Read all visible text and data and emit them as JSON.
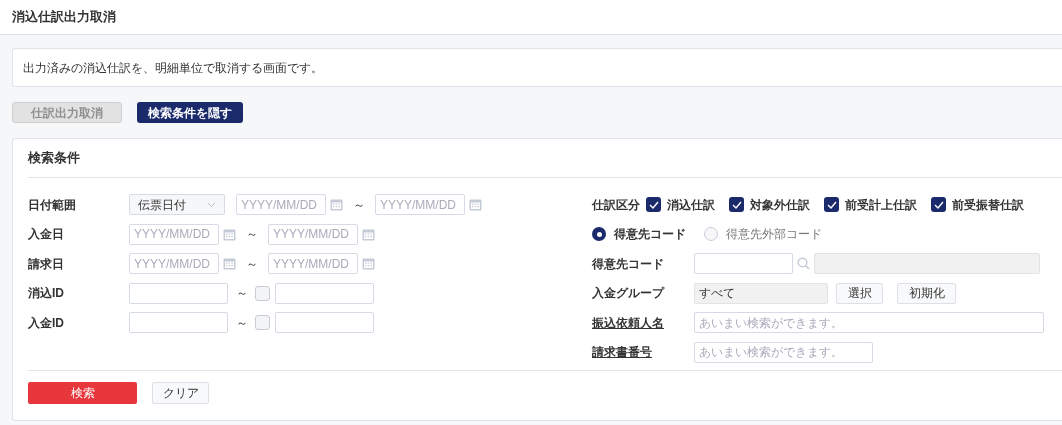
{
  "header": {
    "title": "消込仕訳出力取消"
  },
  "description": "出力済みの消込仕訳を、明細単位で取消する画面です。",
  "toolbar": [
    {
      "label": "仕訳出力取消",
      "disabled": true
    },
    {
      "label": "検索条件を隠す",
      "disabled": false
    }
  ],
  "search_panel": {
    "title": "検索条件",
    "left_rows": [
      {
        "kind": "date",
        "label": "日付範囲",
        "select": "伝票日付",
        "from_placeholder": "YYYY/MM/DD",
        "separator": "～",
        "to_placeholder": "YYYY/MM/DD"
      },
      {
        "kind": "date",
        "label": "入金日",
        "from_placeholder": "YYYY/MM/DD",
        "separator": "～",
        "to_placeholder": "YYYY/MM/DD"
      },
      {
        "kind": "date",
        "label": "請求日",
        "from_placeholder": "YYYY/MM/DD",
        "separator": "～",
        "to_placeholder": "YYYY/MM/DD"
      },
      {
        "kind": "id",
        "label": "消込ID",
        "separator": "～",
        "checked": false
      },
      {
        "kind": "id",
        "label": "入金ID",
        "separator": "～",
        "checked": false
      }
    ],
    "journal_type": {
      "label": "仕訳区分",
      "options": [
        {
          "label": "消込仕訳",
          "checked": true
        },
        {
          "label": "対象外仕訳",
          "checked": true
        },
        {
          "label": "前受計上仕訳",
          "checked": true
        },
        {
          "label": "前受振替仕訳",
          "checked": true
        }
      ]
    },
    "code_type": [
      {
        "label": "得意先コード",
        "selected": true
      },
      {
        "label": "得意先外部コード",
        "selected": false
      }
    ],
    "customer_code": {
      "label": "得意先コード"
    },
    "payment_group": {
      "label": "入金グループ",
      "value": "すべて",
      "buttons": [
        "選択",
        "初期化"
      ]
    },
    "remitter_name": {
      "label": "振込依頼人名",
      "placeholder": "あいまい検索ができます。"
    },
    "invoice_number": {
      "label": "請求書番号",
      "placeholder": "あいまい検索ができます。"
    },
    "actions": [
      {
        "kind": "primary",
        "label": "検索"
      },
      {
        "kind": "secondary",
        "label": "クリア"
      }
    ]
  }
}
